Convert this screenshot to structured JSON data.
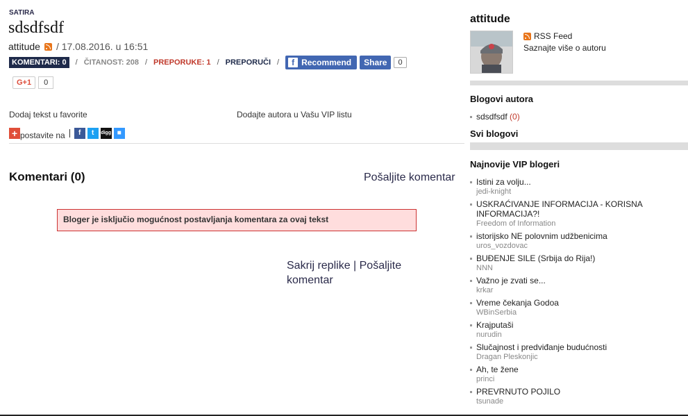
{
  "article": {
    "category": "SATIRA",
    "title": "sdsdfsdf",
    "author": "attitude",
    "date": "/ 17.08.2016. u 16:51"
  },
  "stats": {
    "comments": "KOMENTARI: 0",
    "reads": "ČITANOST: 208",
    "recommendations": "PREPORUKE: 1",
    "recommend": "PREPORUČI",
    "sep": "/"
  },
  "social": {
    "fb_recommend": "Recommend",
    "fb_share": "Share",
    "fb_count": "0",
    "gplus_label": "G+1",
    "gplus_count": "0"
  },
  "links": {
    "favorites": "Dodaj tekst u favorite",
    "vip": "Dodajte autora u Vašu VIP listu",
    "postavite": "postavite na"
  },
  "share_icons": [
    "facebook-icon",
    "twitter-icon",
    "digg-icon",
    "delicious-icon"
  ],
  "comments": {
    "heading": "Komentari (0)",
    "send": "Pošaljite komentar",
    "disabled_notice": "Bloger je isključio mogućnost postavljanja komentara za ovaj tekst",
    "hide_replies": "Sakrij replike | Pošaljite komentar"
  },
  "sidebar": {
    "username": "attitude",
    "rss": "RSS Feed",
    "about": "Saznajte više o autoru",
    "blogs_heading": "Blogovi autora",
    "blog_name": "sdsdfsdf",
    "blog_count": "(0)",
    "all_blogs": "Svi blogovi",
    "vip_heading": "Najnovije VIP blogeri",
    "vip": [
      {
        "title": "Istini za volju...",
        "author": "jedi-knight"
      },
      {
        "title": "USKRAĆIVANJE INFORMACIJA - KORISNA INFORMACIJA?!",
        "author": "Freedom of Information"
      },
      {
        "title": "istorijsko NE polovnim udžbenicima",
        "author": "uros_vozdovac"
      },
      {
        "title": "BUĐENJE SILE (Srbija do Rija!)",
        "author": "NNN"
      },
      {
        "title": "Važno je zvati se...",
        "author": "krkar"
      },
      {
        "title": "Vreme čekanja Godoa",
        "author": "WBinSerbia"
      },
      {
        "title": "Krajputaši",
        "author": "nurudin"
      },
      {
        "title": "Slučajnost i predviđanje budućnosti",
        "author": "Dragan Pleskonjic"
      },
      {
        "title": "Ah, te žene",
        "author": "princi"
      },
      {
        "title": "PREVRNUTO POJILO",
        "author": "tsunade"
      }
    ]
  }
}
